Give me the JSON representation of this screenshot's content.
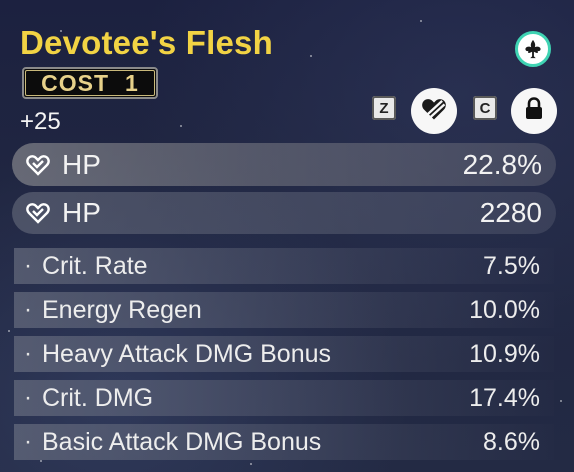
{
  "echo": {
    "name": "Devotee's Flesh",
    "cost_label": "COST",
    "cost_value": "1",
    "level": "+25"
  },
  "controls": {
    "sonata_icon": "fleur-de-lis-icon",
    "key_z": "Z",
    "key_c": "C",
    "discard_icon": "heart-slash-icon",
    "lock_icon": "lock-icon"
  },
  "main_stats": [
    {
      "icon": "heart-hp-icon",
      "label": "HP",
      "value": "22.8%"
    },
    {
      "icon": "heart-hp-icon",
      "label": "HP",
      "value": "2280"
    }
  ],
  "sub_stats": [
    {
      "label": "Crit. Rate",
      "value": "7.5%"
    },
    {
      "label": "Energy Regen",
      "value": "10.0%"
    },
    {
      "label": "Heavy Attack DMG Bonus",
      "value": "10.9%"
    },
    {
      "label": "Crit. DMG",
      "value": "17.4%"
    },
    {
      "label": "Basic Attack DMG Bonus",
      "value": "8.6%"
    }
  ],
  "colors": {
    "title": "#f2d344",
    "sonata_ring": "#3fd3b3",
    "background": "#1f2540"
  }
}
